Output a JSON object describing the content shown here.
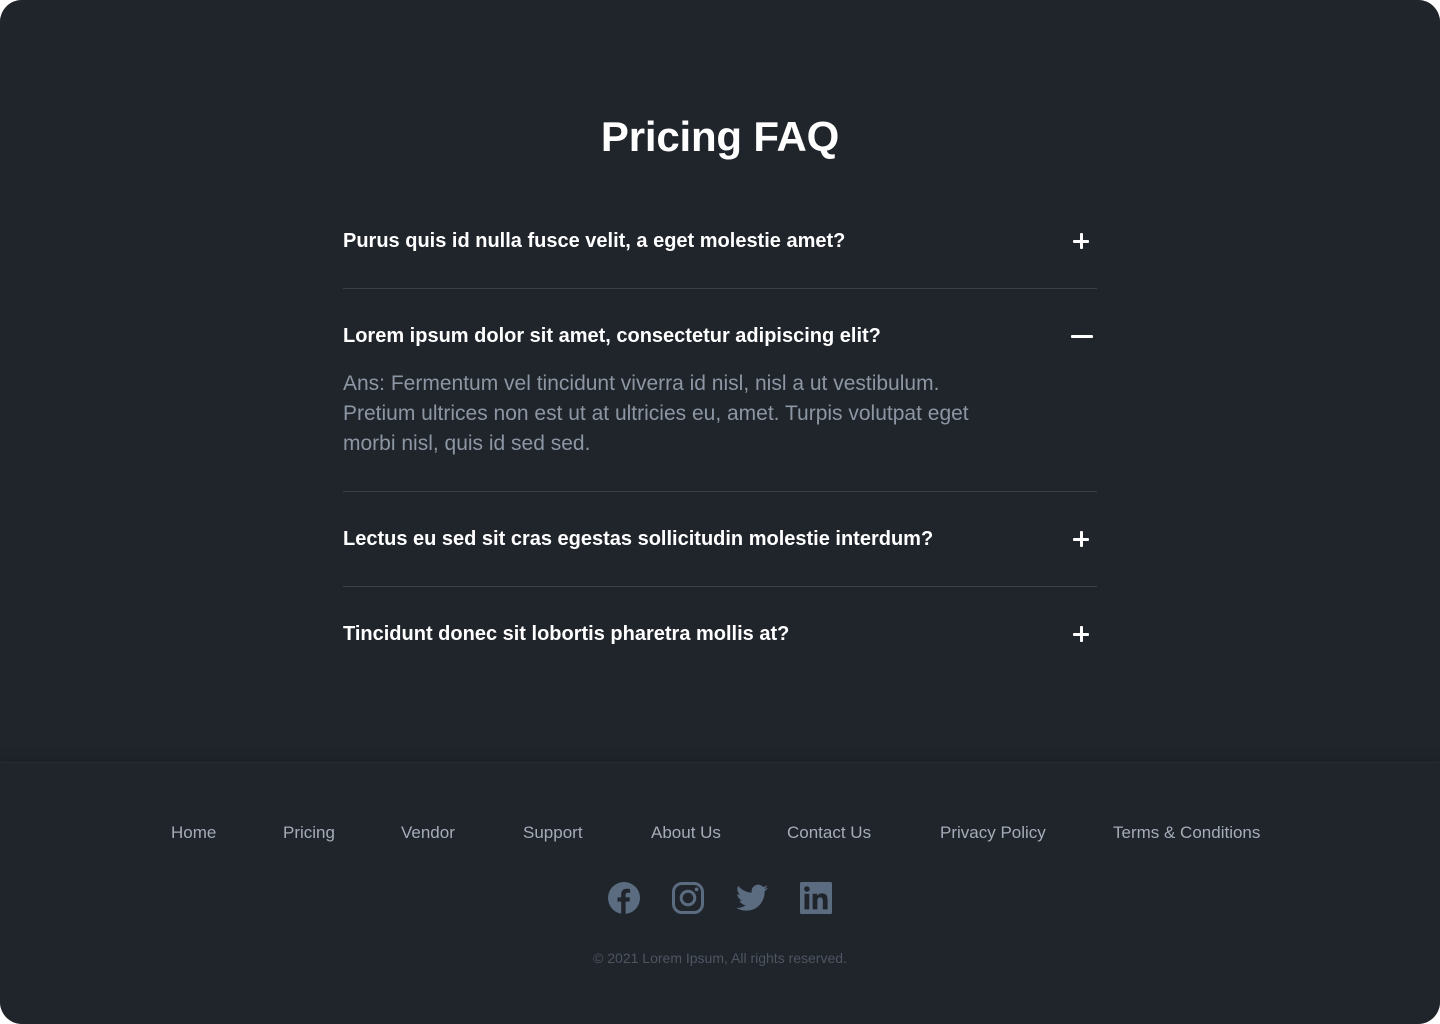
{
  "faq": {
    "title": "Pricing FAQ",
    "items": [
      {
        "question": "Purus quis id nulla fusce velit, a eget molestie amet?",
        "expanded": false,
        "toggle_icon": "plus-icon"
      },
      {
        "question": "Lorem ipsum dolor sit amet, consectetur adipiscing elit?",
        "expanded": true,
        "toggle_icon": "minus-icon",
        "answer": "Ans: Fermentum vel tincidunt viverra id nisl, nisl a ut vestibulum. Pretium ultrices non est ut at ultricies eu, amet. Turpis volutpat eget morbi nisl, quis id sed sed."
      },
      {
        "question": "Lectus eu sed sit cras egestas sollicitudin molestie interdum?",
        "expanded": false,
        "toggle_icon": "plus-icon"
      },
      {
        "question": "Tincidunt donec sit lobortis pharetra mollis at?",
        "expanded": false,
        "toggle_icon": "plus-icon"
      }
    ]
  },
  "footer": {
    "nav": [
      "Home",
      "Pricing",
      "Vendor",
      "Support",
      "About Us",
      "Contact Us",
      "Privacy Policy",
      "Terms & Conditions"
    ],
    "social": [
      "facebook-icon",
      "instagram-icon",
      "twitter-icon",
      "linkedin-icon"
    ],
    "copyright": "© 2021 Lorem Ipsum, All rights reserved."
  },
  "colors": {
    "background": "#20252c",
    "heading": "#ffffff",
    "answer_text": "#8d96a3",
    "divider": "#3a414a",
    "footer_link": "#a4acb8",
    "social_icon": "#5b6b80",
    "copyright": "#4d5561"
  }
}
